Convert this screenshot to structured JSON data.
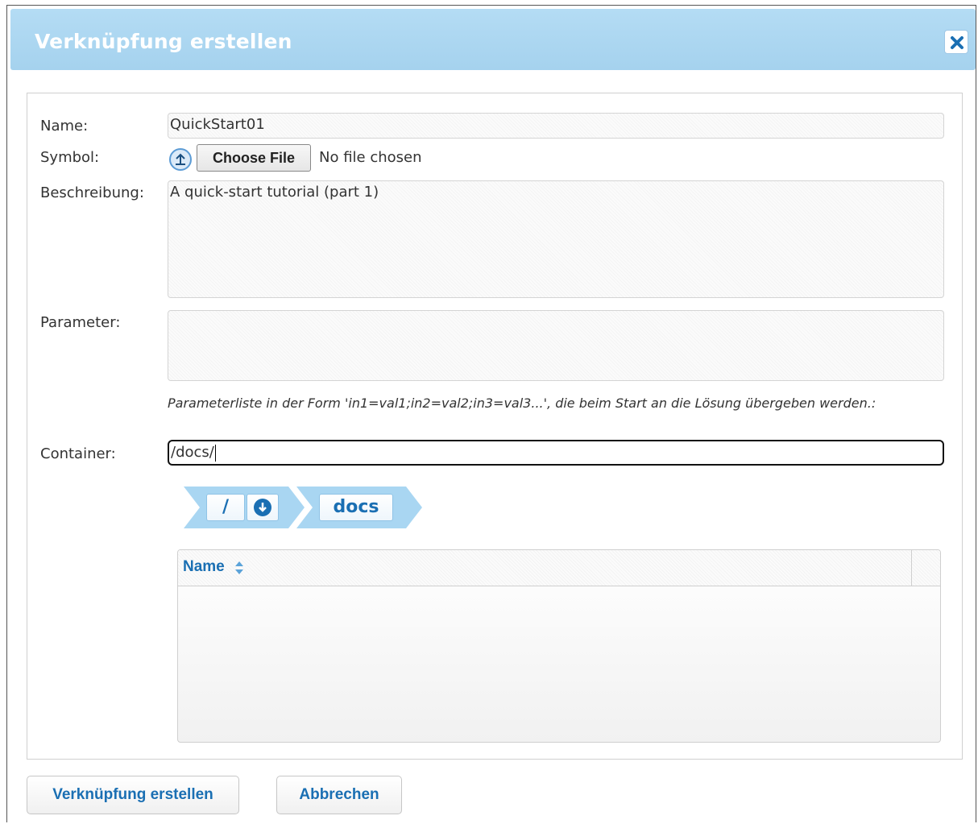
{
  "dialog": {
    "title": "Verknüpfung erstellen",
    "close_icon": "close-icon"
  },
  "form": {
    "name_label": "Name:",
    "name_value": "QuickStart01",
    "symbol_label": "Symbol:",
    "choose_file_label": "Choose File",
    "no_file_text": "No file chosen",
    "description_label": "Beschreibung:",
    "description_value": "A quick-start tutorial (part 1)",
    "parameter_label": "Parameter:",
    "parameter_value": "",
    "parameter_hint": "Parameterliste in der Form 'in1=val1;in2=val2;in3=val3...', die beim Start an die Lösung übergeben werden.:",
    "container_label": "Container:",
    "container_value": "/docs/"
  },
  "breadcrumb": {
    "root_label": "/",
    "docs_label": "docs"
  },
  "grid": {
    "name_header": "Name",
    "rows": []
  },
  "footer": {
    "create_label": "Verknüpfung erstellen",
    "cancel_label": "Abbrechen"
  },
  "colors": {
    "titlebar": "#b4dcf4",
    "accent": "#1a6fb3",
    "breadcrumb": "#a9d6f2"
  }
}
